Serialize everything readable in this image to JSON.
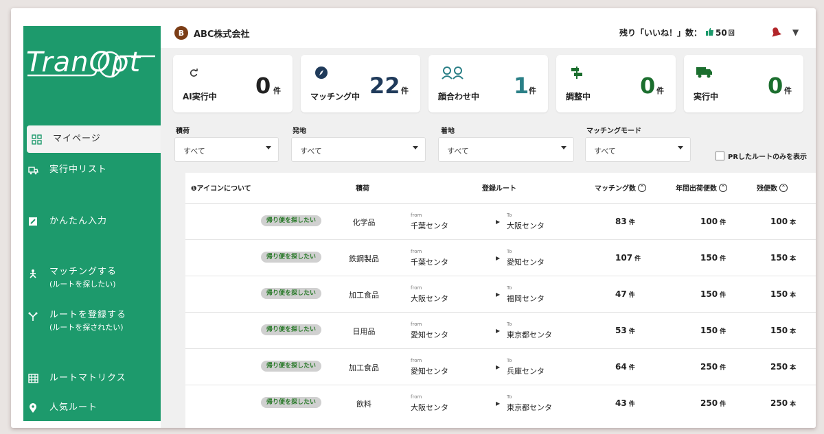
{
  "app": {
    "logo": "TranOpt",
    "brand_color": "#1d9a6c"
  },
  "sidebar": {
    "items": [
      {
        "label": "マイページ",
        "sub": "",
        "icon": "dashboard-icon"
      },
      {
        "label": "実行中リスト",
        "sub": "",
        "icon": "truck-list-icon"
      },
      {
        "label": "かんたん入力",
        "sub": "",
        "icon": "edit-icon"
      },
      {
        "label": "マッチングする",
        "sub": "(ルートを探したい)",
        "icon": "matching-icon"
      },
      {
        "label": "ルートを登録する",
        "sub": "(ルートを探されたい)",
        "icon": "route-fork-icon"
      },
      {
        "label": "ルートマトリクス",
        "sub": "",
        "icon": "grid-icon"
      },
      {
        "label": "人気ルート",
        "sub": "",
        "icon": "pin-icon"
      }
    ]
  },
  "header": {
    "company_badge": "B",
    "company_name": "ABC株式会社",
    "likes_label": "残り「いいね！」数：",
    "likes_count": "50",
    "likes_unit": "回"
  },
  "cards": [
    {
      "label": "AI実行中",
      "value": "0",
      "unit": "件",
      "icon": "refresh-icon",
      "color": "#222222"
    },
    {
      "label": "マッチング中",
      "value": "22",
      "unit": "件",
      "icon": "compass-icon",
      "color": "#1f3a5a"
    },
    {
      "label": "顔合わせ中",
      "value": "1",
      "unit": "件",
      "icon": "people-icon",
      "color": "#2a7f86"
    },
    {
      "label": "調整中",
      "value": "0",
      "unit": "件",
      "icon": "signpost-icon",
      "color": "#1b6e2e"
    },
    {
      "label": "実行中",
      "value": "0",
      "unit": "件",
      "icon": "truck-icon",
      "color": "#1b6e2e"
    }
  ],
  "filters": [
    {
      "label": "積荷",
      "value": "すべて"
    },
    {
      "label": "発地",
      "value": "すべて"
    },
    {
      "label": "着地",
      "value": "すべて"
    },
    {
      "label": "マッチングモード",
      "value": "すべて"
    }
  ],
  "pr_only_label": "PRしたルートのみを表示",
  "table": {
    "headers": {
      "icon_info": "❶アイコンについて",
      "cargo": "積荷",
      "route": "登録ルート",
      "matches": "マッチング数",
      "annual": "年間出荷便数",
      "remaining": "残便数"
    },
    "from_label": "from",
    "to_label": "To",
    "rows": [
      {
        "tag": "帰り便を探したい",
        "cargo": "化学品",
        "from": "千葉センタ",
        "to": "大阪センタ",
        "matches": "83",
        "matches_unit": "件",
        "annual": "100",
        "annual_unit": "件",
        "remaining": "100",
        "remaining_unit": "本"
      },
      {
        "tag": "帰り便を探したい",
        "cargo": "鉄鋼製品",
        "from": "千葉センタ",
        "to": "愛知センタ",
        "matches": "107",
        "matches_unit": "件",
        "annual": "150",
        "annual_unit": "件",
        "remaining": "150",
        "remaining_unit": "本"
      },
      {
        "tag": "帰り便を探したい",
        "cargo": "加工食品",
        "from": "大阪センタ",
        "to": "福岡センタ",
        "matches": "47",
        "matches_unit": "件",
        "annual": "150",
        "annual_unit": "件",
        "remaining": "150",
        "remaining_unit": "本"
      },
      {
        "tag": "帰り便を探したい",
        "cargo": "日用品",
        "from": "愛知センタ",
        "to": "東京都センタ",
        "matches": "53",
        "matches_unit": "件",
        "annual": "150",
        "annual_unit": "件",
        "remaining": "150",
        "remaining_unit": "本"
      },
      {
        "tag": "帰り便を探したい",
        "cargo": "加工食品",
        "from": "愛知センタ",
        "to": "兵庫センタ",
        "matches": "64",
        "matches_unit": "件",
        "annual": "250",
        "annual_unit": "件",
        "remaining": "250",
        "remaining_unit": "本"
      },
      {
        "tag": "帰り便を探したい",
        "cargo": "飲料",
        "from": "大阪センタ",
        "to": "東京都センタ",
        "matches": "43",
        "matches_unit": "件",
        "annual": "250",
        "annual_unit": "件",
        "remaining": "250",
        "remaining_unit": "本"
      }
    ]
  }
}
